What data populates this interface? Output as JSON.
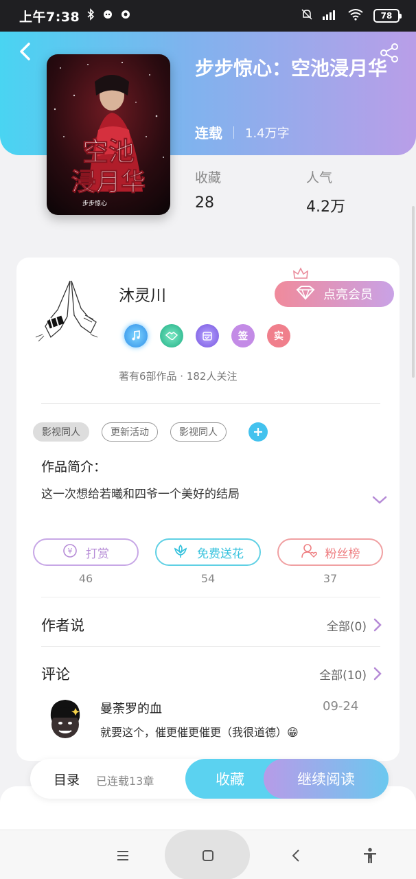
{
  "status_bar": {
    "time": "上午7:38",
    "battery": "78",
    "icons": [
      "bluetooth-icon",
      "notification-icon",
      "notification-icon",
      "mute-icon",
      "signal-icon",
      "wifi-icon",
      "battery-icon"
    ]
  },
  "book": {
    "title": "步步惊心：空池浸月华",
    "status": "连载",
    "word_count": "1.4万字",
    "stats": [
      {
        "label": "收藏",
        "value": "28"
      },
      {
        "label": "人气",
        "value": "4.2万"
      }
    ],
    "cover_text": "空池浸月华",
    "cover_subtext": "步步惊心"
  },
  "author": {
    "name": "沐灵川",
    "vip_button": "点亮会员",
    "stats": "著有6部作品 · 182人关注",
    "badges": [
      {
        "icon": "music-badge-icon",
        "color": "#3bb6f0"
      },
      {
        "icon": "handshake-badge-icon",
        "color": "#2ec79a"
      },
      {
        "icon": "calendar-badge-icon",
        "color": "#8b6ee8"
      },
      {
        "label": "签",
        "color": "#c38be6"
      },
      {
        "label": "实",
        "color": "#f07f8c"
      }
    ]
  },
  "tags": [
    "影视同人",
    "更新活动",
    "影视同人"
  ],
  "intro": {
    "title": "作品简介：",
    "text": "这一次想给若曦和四爷一个美好的结局"
  },
  "actions": [
    {
      "label": "打赏",
      "count": "46",
      "color": "#b58ad6",
      "icon": "coin-icon"
    },
    {
      "label": "免费送花",
      "count": "54",
      "color": "#36c2dd",
      "icon": "flower-icon"
    },
    {
      "label": "粉丝榜",
      "count": "37",
      "color": "#ee7f82",
      "icon": "fan-icon"
    }
  ],
  "author_says": {
    "title": "作者说",
    "more": "全部(0)"
  },
  "comments": {
    "title": "评论",
    "more": "全部(10)",
    "items": [
      {
        "user": "曼荼罗的血",
        "date": "09-24",
        "text": "就要这个，催更催更催更（我很道德）😁"
      }
    ]
  },
  "bottom_bar": {
    "toc": "目录",
    "progress": "已连载13章",
    "favorite": "收藏",
    "continue": "继续阅读"
  },
  "colors": {
    "header_start": "#49d4f2",
    "header_end": "#b99ee8",
    "accent_purple": "#b58ad6"
  }
}
